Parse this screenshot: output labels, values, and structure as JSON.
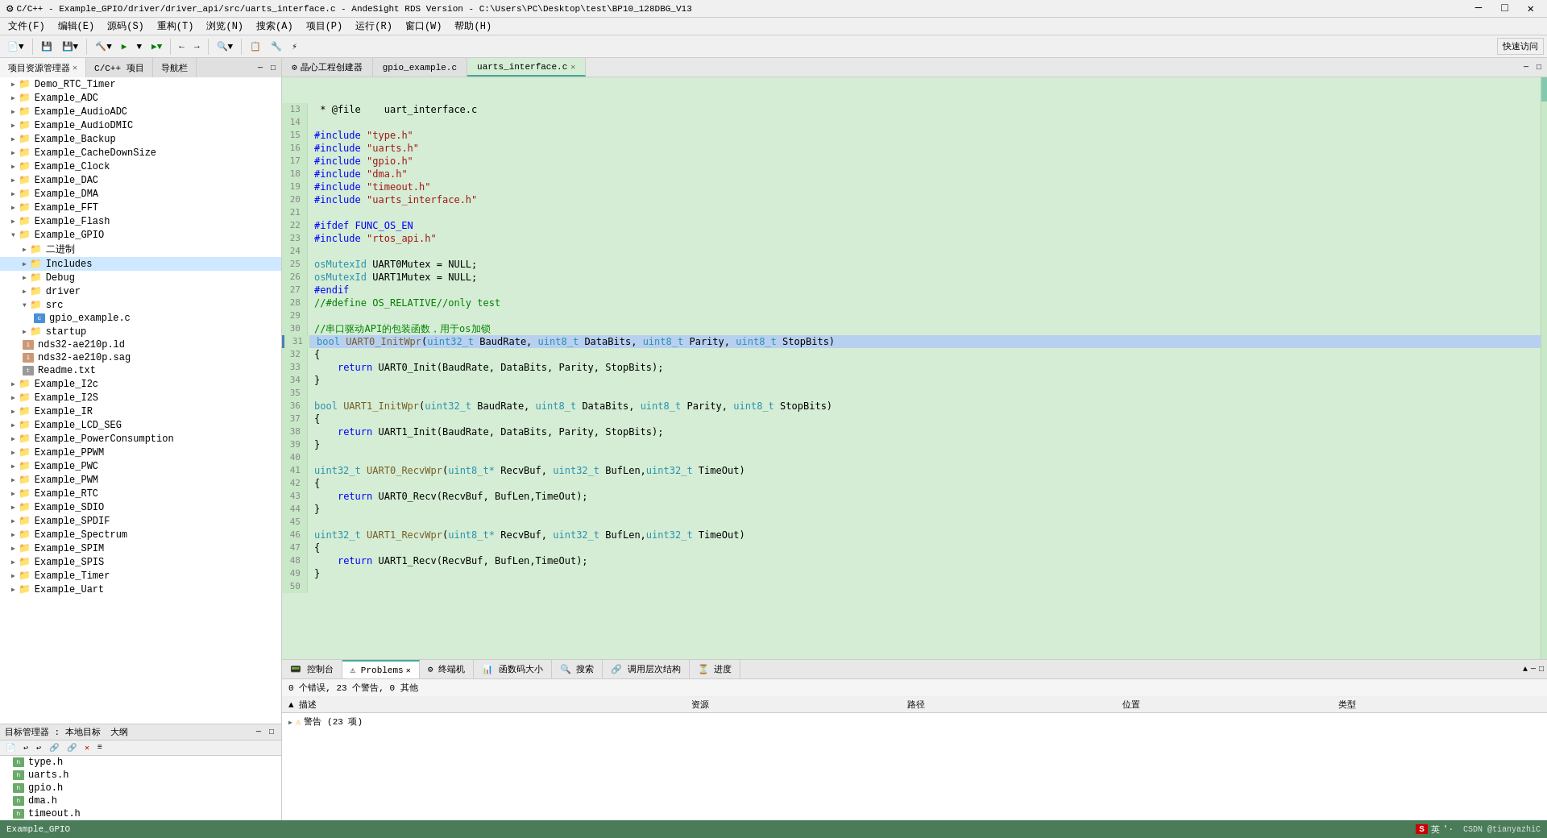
{
  "titlebar": {
    "title": "C/C++ - Example_GPIO/driver/driver_api/src/uarts_interface.c - AndeSight RDS Version - C:\\Users\\PC\\Desktop\\test\\BP10_128DBG_V13",
    "minimize": "─",
    "maximize": "□",
    "close": "✕"
  },
  "menubar": {
    "items": [
      "文件(F)",
      "编辑(E)",
      "源码(S)",
      "重构(T)",
      "浏览(N)",
      "搜索(A)",
      "项目(P)",
      "运行(R)",
      "窗口(W)",
      "帮助(H)"
    ]
  },
  "toolbar": {
    "quick_access": "快速访问"
  },
  "left_panel": {
    "project_explorer_label": "项目资源管理器",
    "cpp_project_label": "C/C++ 项目",
    "guide_label": "导航栏",
    "tree_items": [
      {
        "id": "Demo_RTC_Timer",
        "label": "Demo_RTC_Timer",
        "indent": 1,
        "type": "project",
        "expanded": false
      },
      {
        "id": "Example_ADC",
        "label": "Example_ADC",
        "indent": 1,
        "type": "project",
        "expanded": false
      },
      {
        "id": "Example_AudioADC",
        "label": "Example_AudioADC",
        "indent": 1,
        "type": "project",
        "expanded": false
      },
      {
        "id": "Example_AudioDMIC",
        "label": "Example_AudioDMIC",
        "indent": 1,
        "type": "project",
        "expanded": false
      },
      {
        "id": "Example_Backup",
        "label": "Example_Backup",
        "indent": 1,
        "type": "project",
        "expanded": false
      },
      {
        "id": "Example_CacheDownSize",
        "label": "Example_CacheDownSize",
        "indent": 1,
        "type": "project",
        "expanded": false
      },
      {
        "id": "Example_Clock",
        "label": "Example_Clock",
        "indent": 1,
        "type": "project",
        "expanded": false
      },
      {
        "id": "Example_DAC",
        "label": "Example_DAC",
        "indent": 1,
        "type": "project",
        "expanded": false
      },
      {
        "id": "Example_DMA",
        "label": "Example_DMA",
        "indent": 1,
        "type": "project",
        "expanded": false
      },
      {
        "id": "Example_FFT",
        "label": "Example_FFT",
        "indent": 1,
        "type": "project",
        "expanded": false
      },
      {
        "id": "Example_Flash",
        "label": "Example_Flash",
        "indent": 1,
        "type": "project",
        "expanded": false
      },
      {
        "id": "Example_GPIO",
        "label": "Example_GPIO",
        "indent": 1,
        "type": "project",
        "expanded": true
      },
      {
        "id": "二进制",
        "label": "二进制",
        "indent": 2,
        "type": "folder",
        "expanded": false
      },
      {
        "id": "Includes",
        "label": "Includes",
        "indent": 2,
        "type": "folder",
        "expanded": false
      },
      {
        "id": "Debug",
        "label": "Debug",
        "indent": 2,
        "type": "folder",
        "expanded": false
      },
      {
        "id": "driver",
        "label": "driver",
        "indent": 2,
        "type": "folder",
        "expanded": false
      },
      {
        "id": "src",
        "label": "src",
        "indent": 2,
        "type": "folder",
        "expanded": true
      },
      {
        "id": "gpio_example.c",
        "label": "gpio_example.c",
        "indent": 3,
        "type": "file_c"
      },
      {
        "id": "startup",
        "label": "startup",
        "indent": 2,
        "type": "folder",
        "expanded": false
      },
      {
        "id": "nds32-ae210p.ld",
        "label": "nds32-ae210p.ld",
        "indent": 2,
        "type": "file_ld"
      },
      {
        "id": "nds32-ae210p.sag",
        "label": "nds32-ae210p.sag",
        "indent": 2,
        "type": "file_ld"
      },
      {
        "id": "Readme.txt",
        "label": "Readme.txt",
        "indent": 2,
        "type": "file_txt"
      },
      {
        "id": "Example_I2c",
        "label": "Example_I2c",
        "indent": 1,
        "type": "project",
        "expanded": false
      },
      {
        "id": "Example_I2S",
        "label": "Example_I2S",
        "indent": 1,
        "type": "project",
        "expanded": false
      },
      {
        "id": "Example_IR",
        "label": "Example_IR",
        "indent": 1,
        "type": "project",
        "expanded": false
      },
      {
        "id": "Example_LCD_SEG",
        "label": "Example_LCD_SEG",
        "indent": 1,
        "type": "project",
        "expanded": false
      },
      {
        "id": "Example_PowerConsumption",
        "label": "Example_PowerConsumption",
        "indent": 1,
        "type": "project",
        "expanded": false
      },
      {
        "id": "Example_PPWM",
        "label": "Example_PPWM",
        "indent": 1,
        "type": "project",
        "expanded": false
      },
      {
        "id": "Example_PWC",
        "label": "Example_PWC",
        "indent": 1,
        "type": "project",
        "expanded": false
      },
      {
        "id": "Example_PWM",
        "label": "Example_PWM",
        "indent": 1,
        "type": "project",
        "expanded": false
      },
      {
        "id": "Example_RTC",
        "label": "Example_RTC",
        "indent": 1,
        "type": "project",
        "expanded": false
      },
      {
        "id": "Example_SDIO",
        "label": "Example_SDIO",
        "indent": 1,
        "type": "project",
        "expanded": false
      },
      {
        "id": "Example_SPDIF",
        "label": "Example_SPDIF",
        "indent": 1,
        "type": "project",
        "expanded": false
      },
      {
        "id": "Example_Spectrum",
        "label": "Example_Spectrum",
        "indent": 1,
        "type": "project",
        "expanded": false
      },
      {
        "id": "Example_SPIM",
        "label": "Example_SPIM",
        "indent": 1,
        "type": "project",
        "expanded": false
      },
      {
        "id": "Example_SPIS",
        "label": "Example_SPIS",
        "indent": 1,
        "type": "project",
        "expanded": false
      },
      {
        "id": "Example_Timer",
        "label": "Example_Timer",
        "indent": 1,
        "type": "project",
        "expanded": false
      },
      {
        "id": "Example_Uart",
        "label": "Example_Uart",
        "indent": 1,
        "type": "project",
        "expanded": false
      }
    ]
  },
  "target_manager": {
    "label": "目标管理器 : 本地目标",
    "outline_label": "大纲",
    "files": [
      {
        "name": "type.h",
        "type": "file_h"
      },
      {
        "name": "uarts.h",
        "type": "file_h"
      },
      {
        "name": "gpio.h",
        "type": "file_h"
      },
      {
        "name": "dma.h",
        "type": "file_h"
      },
      {
        "name": "timeout.h",
        "type": "file_h"
      }
    ]
  },
  "editor": {
    "tabs": [
      {
        "label": "晶心工程创建器",
        "active": false,
        "closable": false
      },
      {
        "label": "gpio_example.c",
        "active": false,
        "closable": false
      },
      {
        "label": "uarts_interface.c",
        "active": true,
        "closable": true
      }
    ],
    "code_lines": [
      {
        "num": 13,
        "content": " * @file    uart_interface.c"
      },
      {
        "num": 14,
        "content": ""
      },
      {
        "num": 15,
        "content": "#include \"type.h\"",
        "type": "include"
      },
      {
        "num": 16,
        "content": "#include \"uarts.h\"",
        "type": "include"
      },
      {
        "num": 17,
        "content": "#include \"gpio.h\"",
        "type": "include"
      },
      {
        "num": 18,
        "content": "#include \"dma.h\"",
        "type": "include"
      },
      {
        "num": 19,
        "content": "#include \"timeout.h\"",
        "type": "include"
      },
      {
        "num": 20,
        "content": "#include \"uarts_interface.h\"",
        "type": "include"
      },
      {
        "num": 21,
        "content": ""
      },
      {
        "num": 22,
        "content": "#ifdef FUNC_OS_EN"
      },
      {
        "num": 23,
        "content": "#include \"rtos_api.h\"",
        "type": "include"
      },
      {
        "num": 24,
        "content": ""
      },
      {
        "num": 25,
        "content": "osMutexId UART0Mutex = NULL;"
      },
      {
        "num": 26,
        "content": "osMutexId UART1Mutex = NULL;"
      },
      {
        "num": 27,
        "content": "#endif"
      },
      {
        "num": 28,
        "content": "//#define OS_RELATIVE//only test"
      },
      {
        "num": 29,
        "content": ""
      },
      {
        "num": 30,
        "content": "//串口驱动API的包装函数，用于os加锁"
      },
      {
        "num": 31,
        "content": "bool UART0_InitWpr(uint32_t BaudRate, uint8_t DataBits, uint8_t Parity, uint8_t StopBits)",
        "highlighted": true
      },
      {
        "num": 32,
        "content": "{"
      },
      {
        "num": 33,
        "content": "    return UART0_Init(BaudRate, DataBits, Parity, StopBits);"
      },
      {
        "num": 34,
        "content": "}"
      },
      {
        "num": 35,
        "content": ""
      },
      {
        "num": 36,
        "content": "bool UART1_InitWpr(uint32_t BaudRate, uint8_t DataBits, uint8_t Parity, uint8_t StopBits)"
      },
      {
        "num": 37,
        "content": "{"
      },
      {
        "num": 38,
        "content": "    return UART1_Init(BaudRate, DataBits, Parity, StopBits);"
      },
      {
        "num": 39,
        "content": "}"
      },
      {
        "num": 40,
        "content": ""
      },
      {
        "num": 41,
        "content": "uint32_t UART0_RecvWpr(uint8_t* RecvBuf, uint32_t BufLen,uint32_t TimeOut)"
      },
      {
        "num": 42,
        "content": "{"
      },
      {
        "num": 43,
        "content": "    return UART0_Recv(RecvBuf, BufLen,TimeOut);"
      },
      {
        "num": 44,
        "content": "}"
      },
      {
        "num": 45,
        "content": ""
      },
      {
        "num": 46,
        "content": "uint32_t UART1_RecvWpr(uint8_t* RecvBuf, uint32_t BufLen,uint32_t TimeOut)"
      },
      {
        "num": 47,
        "content": "{"
      },
      {
        "num": 48,
        "content": "    return UART1_Recv(RecvBuf, BufLen,TimeOut);"
      },
      {
        "num": 49,
        "content": "}"
      },
      {
        "num": 50,
        "content": ""
      }
    ]
  },
  "bottom_panel": {
    "tabs": [
      "控制台",
      "Problems",
      "终端机",
      "函数码大小",
      "搜索",
      "调用层次结构",
      "进度"
    ],
    "active_tab": "Problems",
    "status_text": "0 个错误, 23 个警告, 0 其他",
    "columns": [
      "描述",
      "资源",
      "路径",
      "位置",
      "类型"
    ],
    "warning_group": "警告 (23 项)"
  },
  "status_bar": {
    "left": "Example_GPIO",
    "right_items": [
      "英",
      "'·"
    ]
  }
}
